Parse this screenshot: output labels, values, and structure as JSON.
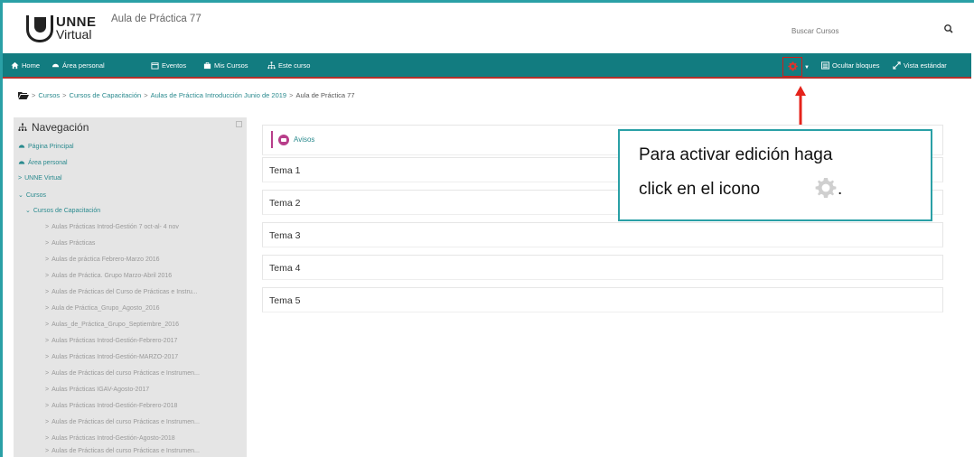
{
  "header": {
    "logo_text_1": "UNNE",
    "logo_text_2": "Virtual",
    "site_title": "Aula de Práctica 77",
    "search_placeholder": "Buscar Cursos"
  },
  "navbar": {
    "items": [
      "Home",
      "Área personal",
      "Eventos",
      "Mis Cursos",
      "Este curso"
    ],
    "right": {
      "hide_blocks": "Ocultar bloques",
      "standard_view": "Vista estándar"
    }
  },
  "breadcrumb": [
    "Cursos",
    "Cursos de Capacitación",
    "Aulas de Práctica Introducción Junio de 2019",
    "Aula de Práctica 77"
  ],
  "sidebar": {
    "title": "Navegación",
    "top_items": [
      "Página Principal",
      "Área personal",
      "UNNE Virtual",
      "Cursos",
      "Cursos de Capacitación"
    ],
    "courses": [
      "Aulas Prácticas Introd-Gestión 7 oct-al- 4 nov",
      "Aulas Prácticas",
      "Aulas de práctica Febrero-Marzo 2016",
      "Aulas de Práctica. Grupo Marzo-Abril 2016",
      "Aulas de Prácticas del Curso de Prácticas e Instru...",
      "Aula de Práctica_Grupo_Agosto_2016",
      "Aulas_de_Práctica_Grupo_Septiembre_2016",
      "Aulas Prácticas Introd-Gestión-Febrero-2017",
      "Aulas Prácticas Introd-Gestión-MARZO-2017",
      "Aulas de Prácticas del curso Prácticas e Instrumen...",
      "Aulas Prácticas IGAV-Agosto-2017",
      "Aulas Prácticas Introd-Gestión-Febrero-2018",
      "Aulas de Prácticas del curso Prácticas e Instrumen...",
      "Aulas Prácticas Introd-Gestión-Agosto-2018",
      "Aulas de Prácticas del curso Prácticas e Instrumen..."
    ]
  },
  "main": {
    "avisos": "Avisos",
    "sections": [
      "Tema 1",
      "Tema 2",
      "Tema 3",
      "Tema 4",
      "Tema 5"
    ]
  },
  "callout": {
    "line1": "Para activar edición haga",
    "line2": "click en el icono",
    "period": "."
  },
  "colors": {
    "nav_bg": "#127c80",
    "accent_teal": "#2a8a8e",
    "highlight_red": "#cc1f1a",
    "forum_purple": "#b83e8a"
  }
}
